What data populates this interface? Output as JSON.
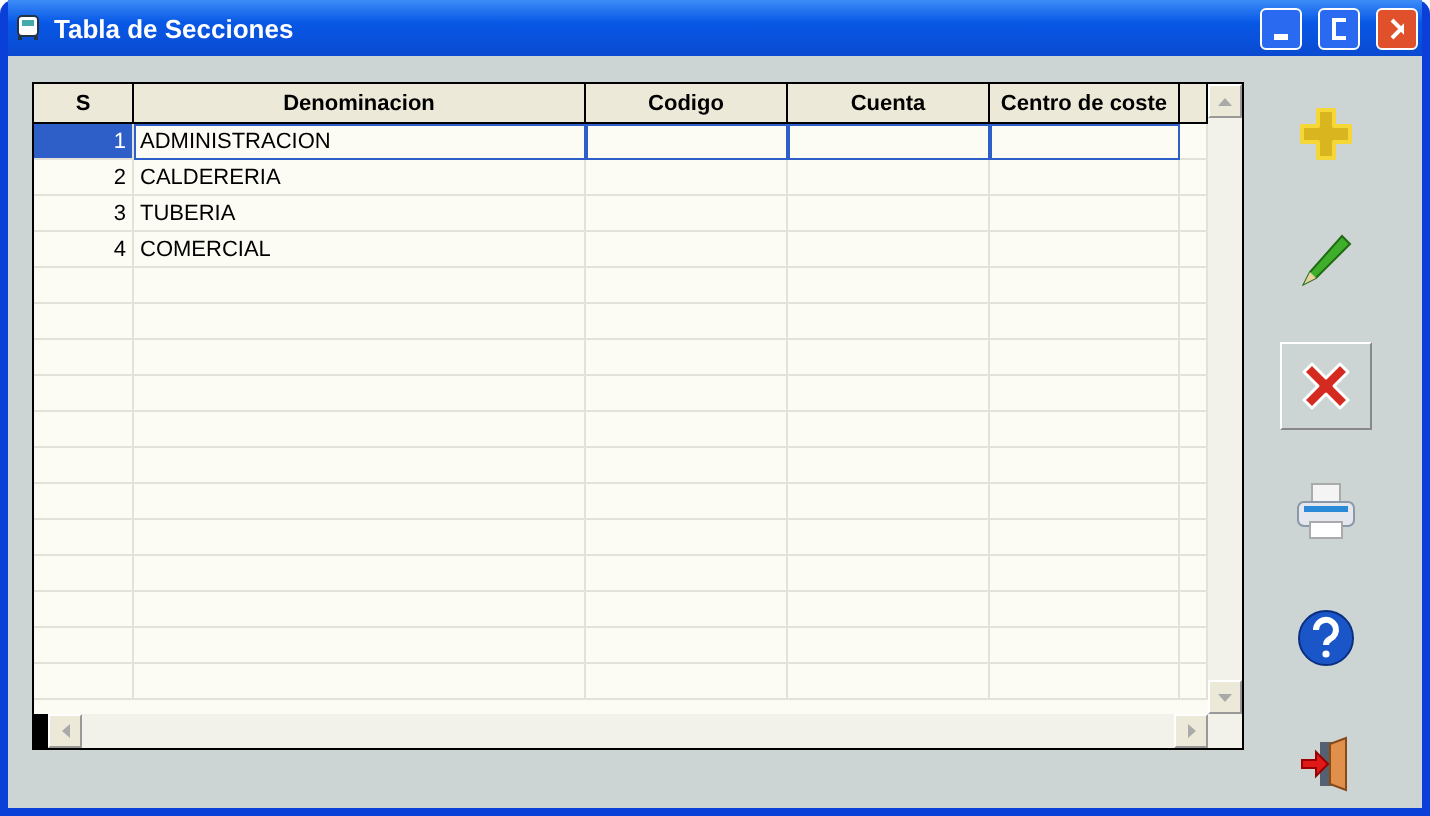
{
  "window": {
    "title": "Tabla de Secciones"
  },
  "table": {
    "columns": [
      "S",
      "Denominacion",
      "Codigo",
      "Cuenta",
      "Centro de coste"
    ],
    "rows": [
      {
        "s": "1",
        "denominacion": "ADMINISTRACION",
        "selected": true
      },
      {
        "s": "2",
        "denominacion": "CALDERERIA",
        "selected": false
      },
      {
        "s": "3",
        "denominacion": "TUBERIA",
        "selected": false
      },
      {
        "s": "4",
        "denominacion": "COMERCIAL",
        "selected": false
      }
    ]
  },
  "toolbar": [
    {
      "kind": "add",
      "highlighted": false
    },
    {
      "kind": "edit",
      "highlighted": false
    },
    {
      "kind": "delete",
      "highlighted": true
    },
    {
      "kind": "print",
      "highlighted": false
    },
    {
      "kind": "help",
      "highlighted": false
    },
    {
      "kind": "exit",
      "highlighted": false
    }
  ]
}
